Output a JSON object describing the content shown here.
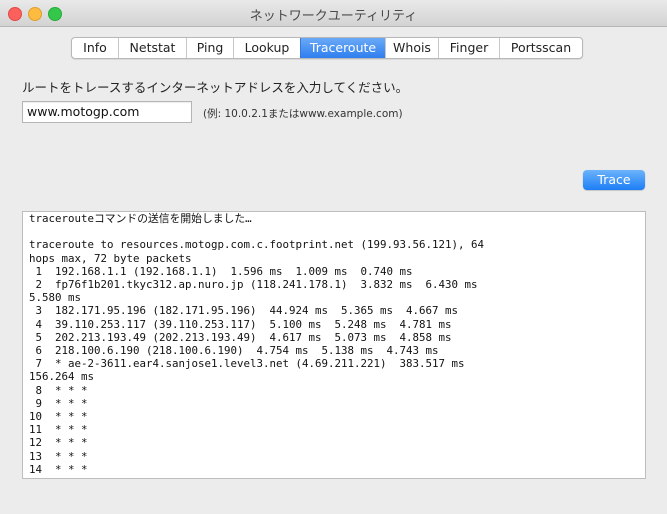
{
  "window": {
    "title": "ネットワークユーティリティ"
  },
  "tabs": [
    {
      "label": "Info"
    },
    {
      "label": "Netstat"
    },
    {
      "label": "Ping"
    },
    {
      "label": "Lookup"
    },
    {
      "label": "Traceroute",
      "active": true
    },
    {
      "label": "Whois"
    },
    {
      "label": "Finger"
    },
    {
      "label": "Portsscan"
    }
  ],
  "traceroute": {
    "prompt": "ルートをトレースするインターネットアドレスを入力してください。",
    "address_value": "www.motogp.com",
    "example": "(例: 10.0.2.1またはwww.example.com)",
    "button_label": "Trace",
    "output_lines": [
      "tracerouteコマンドの送信を開始しました…",
      "",
      "traceroute to resources.motogp.com.c.footprint.net (199.93.56.121), 64",
      "hops max, 72 byte packets",
      " 1  192.168.1.1 (192.168.1.1)  1.596 ms  1.009 ms  0.740 ms",
      " 2  fp76f1b201.tkyc312.ap.nuro.jp (118.241.178.1)  3.832 ms  6.430 ms",
      "5.580 ms",
      " 3  182.171.95.196 (182.171.95.196)  44.924 ms  5.365 ms  4.667 ms",
      " 4  39.110.253.117 (39.110.253.117)  5.100 ms  5.248 ms  4.781 ms",
      " 5  202.213.193.49 (202.213.193.49)  4.617 ms  5.073 ms  4.858 ms",
      " 6  218.100.6.190 (218.100.6.190)  4.754 ms  5.138 ms  4.743 ms",
      " 7  * ae-2-3611.ear4.sanjose1.level3.net (4.69.211.221)  383.517 ms",
      "156.264 ms",
      " 8  * * *",
      " 9  * * *",
      "10  * * *",
      "11  * * *",
      "12  * * *",
      "13  * * *",
      "14  * * *"
    ]
  },
  "colors": {
    "accent": "#2f7ff0",
    "close": "#fc605c",
    "minimize": "#fdbc40",
    "maximize": "#34c84a"
  }
}
